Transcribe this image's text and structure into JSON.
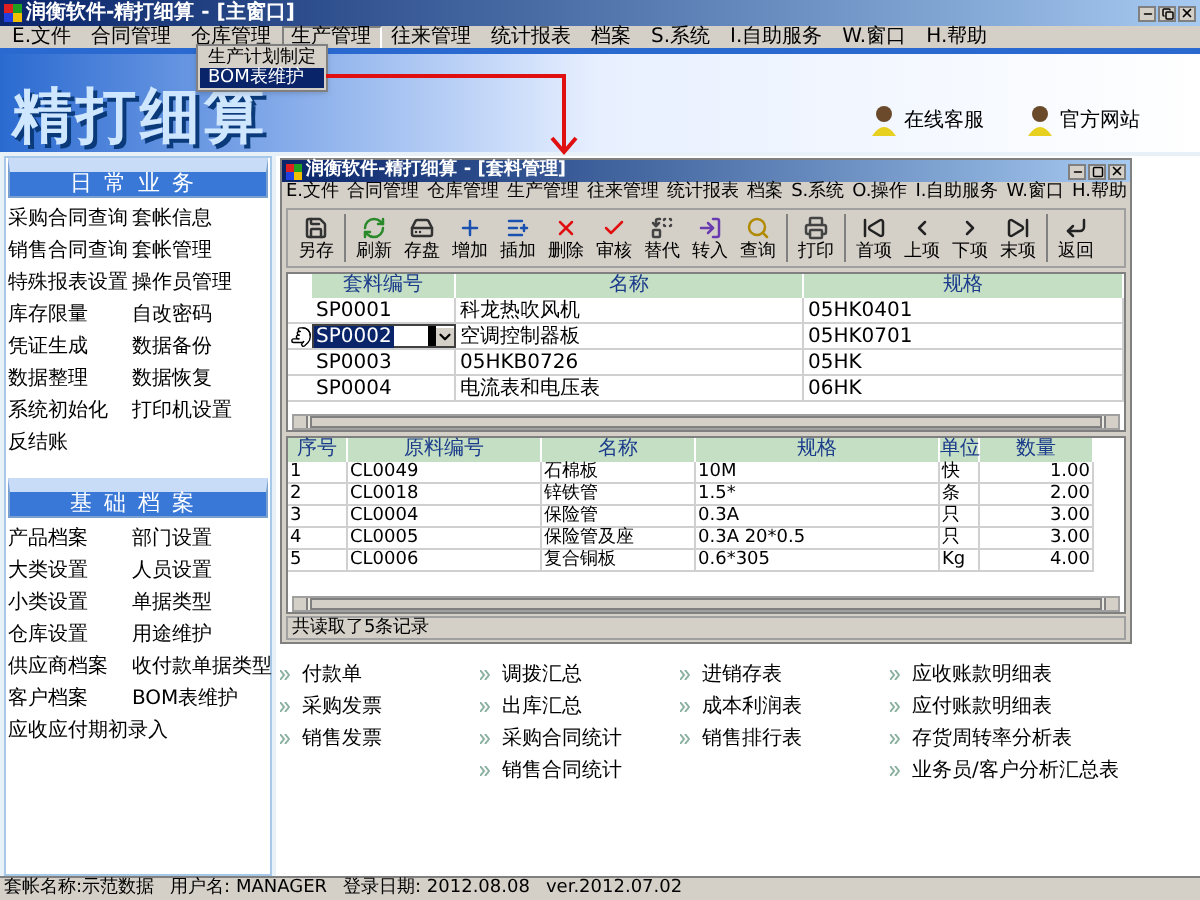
{
  "window": {
    "title": "润衡软件-精打细算 - [主窗口]"
  },
  "menu": [
    {
      "label": "E.文件",
      "selected": false
    },
    {
      "label": "合同管理",
      "selected": false
    },
    {
      "label": "仓库管理",
      "selected": false
    },
    {
      "label": "生产管理",
      "selected": true
    },
    {
      "label": "往来管理",
      "selected": false
    },
    {
      "label": "统计报表",
      "selected": false
    },
    {
      "label": "档案",
      "selected": false
    },
    {
      "label": "S.系统",
      "selected": false
    },
    {
      "label": "I.自助服务",
      "selected": false
    },
    {
      "label": "W.窗口",
      "selected": false
    },
    {
      "label": "H.帮助",
      "selected": false
    }
  ],
  "dropdown": [
    {
      "label": "生产计划制定",
      "selected": false
    },
    {
      "label": "BOM表维护",
      "selected": true
    }
  ],
  "banner": {
    "logo": "精打细算",
    "links": [
      "在线客服",
      "官方网站"
    ]
  },
  "sidebar": [
    {
      "title": "日常业务",
      "items": [
        "采购合同查询",
        "套帐信息",
        "销售合同查询",
        "套帐管理",
        "特殊报表设置",
        "操作员管理",
        "库存限量",
        "自改密码",
        "凭证生成",
        "数据备份",
        "数据整理",
        "数据恢复",
        "系统初始化",
        "打印机设置",
        "反结账"
      ]
    },
    {
      "title": "基础档案",
      "items": [
        "产品档案",
        "部门设置",
        "大类设置",
        "人员设置",
        "小类设置",
        "单据类型",
        "仓库设置",
        "用途维护",
        "供应商档案",
        "收付款单据类型",
        "客户档案",
        "BOM表维护",
        "应收应付期初录入"
      ]
    }
  ],
  "child_window": {
    "title": "润衡软件-精打细算 - [套料管理]",
    "menu": [
      "E.文件",
      "合同管理",
      "仓库管理",
      "生产管理",
      "往来管理",
      "统计报表",
      "档案",
      "S.系统",
      "O.操作",
      "I.自助服务",
      "W.窗口",
      "H.帮助"
    ],
    "toolbar": [
      "另存",
      "刷新",
      "存盘",
      "增加",
      "插加",
      "删除",
      "审核",
      "替代",
      "转入",
      "查询",
      "打印",
      "首项",
      "上项",
      "下项",
      "末项",
      "返回"
    ],
    "kit_table": {
      "columns": [
        "套料编号",
        "名称",
        "规格"
      ],
      "rows": [
        {
          "cells": [
            "SP0001",
            "科龙热吹风机",
            "05HK0401"
          ],
          "selected": false
        },
        {
          "cells": [
            "SP0002",
            "空调控制器板",
            "05HK0701"
          ],
          "selected": true
        },
        {
          "cells": [
            "SP0003",
            "05HKB0726",
            "05HK"
          ],
          "selected": false
        },
        {
          "cells": [
            "SP0004",
            "电流表和电压表",
            "06HK"
          ],
          "selected": false
        }
      ]
    },
    "material_table": {
      "columns": [
        "序号",
        "原料编号",
        "名称",
        "规格",
        "单位",
        "数量"
      ],
      "rows": [
        [
          "1",
          "CL0049",
          "石棉板",
          "10M",
          "快",
          "1.00"
        ],
        [
          "2",
          "CL0018",
          "锌铁管",
          "1.5*",
          "条",
          "2.00"
        ],
        [
          "3",
          "CL0004",
          "保险管",
          "0.3A",
          "只",
          "3.00"
        ],
        [
          "4",
          "CL0005",
          "保险管及座",
          "0.3A 20*0.5",
          "只",
          "3.00"
        ],
        [
          "5",
          "CL0006",
          "复合铜板",
          "0.6*305",
          "Kg",
          "4.00"
        ]
      ]
    },
    "status": "共读取了5条记录"
  },
  "report_links": [
    [
      "付款单",
      "采购发票",
      "销售发票"
    ],
    [
      "调拨汇总",
      "出库汇总",
      "采购合同统计",
      "销售合同统计"
    ],
    [
      "进销存表",
      "成本利润表",
      "销售排行表"
    ],
    [
      "应收账款明细表",
      "应付账款明细表",
      "存货周转率分析表",
      "业务员/客户分析汇总表"
    ]
  ],
  "status_bar": [
    "套帐名称:示范数据",
    "用户名: MANAGER",
    "登录日期: 2012.08.08",
    "ver.2012.07.02"
  ]
}
